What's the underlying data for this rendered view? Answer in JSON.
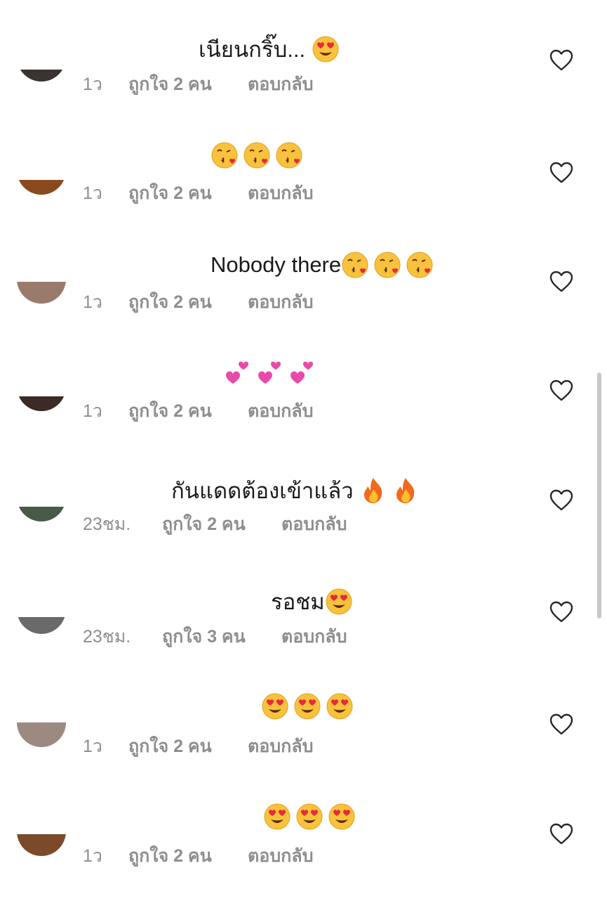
{
  "comments": [
    {
      "text": "เนียนกริ๊บ... ",
      "emoji": [
        "heart-eyes"
      ],
      "time": "1ว",
      "likes": "ถูกใจ 2 คน",
      "reply": "ตอบกลับ",
      "avatar_color": "#3a3330",
      "avatar_fill": 0.25
    },
    {
      "text": "",
      "emoji": [
        "kiss",
        "kiss",
        "kiss"
      ],
      "time": "1ว",
      "likes": "ถูกใจ 2 คน",
      "reply": "ตอบกลับ",
      "avatar_color": "#8a4a1e",
      "avatar_fill": 0.3
    },
    {
      "text": "Nobody there",
      "emoji": [
        "kiss",
        "kiss",
        "kiss"
      ],
      "time": "1ว",
      "likes": "ถูกใจ 2 คน",
      "reply": "ตอบกลับ",
      "avatar_color": "#9a7a6a",
      "avatar_fill": 0.45
    },
    {
      "text": "",
      "emoji": [
        "two-hearts",
        "two-hearts",
        "two-hearts"
      ],
      "time": "1ว",
      "likes": "ถูกใจ 2 คน",
      "reply": "ตอบกลับ",
      "avatar_color": "#3b2a26",
      "avatar_fill": 0.3
    },
    {
      "text": "กันแดดต้องเข้าแล้ว ",
      "emoji": [
        "fire",
        "fire"
      ],
      "time": "23ชม.",
      "likes": "ถูกใจ 2 คน",
      "reply": "ตอบกลับ",
      "avatar_color": "#4a5a48",
      "avatar_fill": 0.3
    },
    {
      "text": "รอชม",
      "emoji": [
        "heart-eyes"
      ],
      "time": "23ชม.",
      "likes": "ถูกใจ 3 คน",
      "reply": "ตอบกลับ",
      "avatar_color": "#6a6a6a",
      "avatar_fill": 0.35
    },
    {
      "text": "",
      "emoji": [
        "heart-eyes",
        "heart-eyes",
        "heart-eyes"
      ],
      "time": "1ว",
      "likes": "ถูกใจ 2 คน",
      "reply": "ตอบกลับ",
      "avatar_color": "#9c8a80",
      "avatar_fill": 0.5
    },
    {
      "text": "",
      "emoji": [
        "heart-eyes",
        "heart-eyes",
        "heart-eyes"
      ],
      "time": "1ว",
      "likes": "ถูกใจ 2 คน",
      "reply": "ตอบกลับ",
      "avatar_color": "#7a4a2a",
      "avatar_fill": 0.45
    }
  ],
  "colors": {
    "text": "#1a1a1a",
    "meta": "#8e8e8e",
    "heart_stroke": "#262626",
    "scrollbar": "#c7c7c7"
  },
  "icons": {
    "like": "heart-outline-icon"
  }
}
